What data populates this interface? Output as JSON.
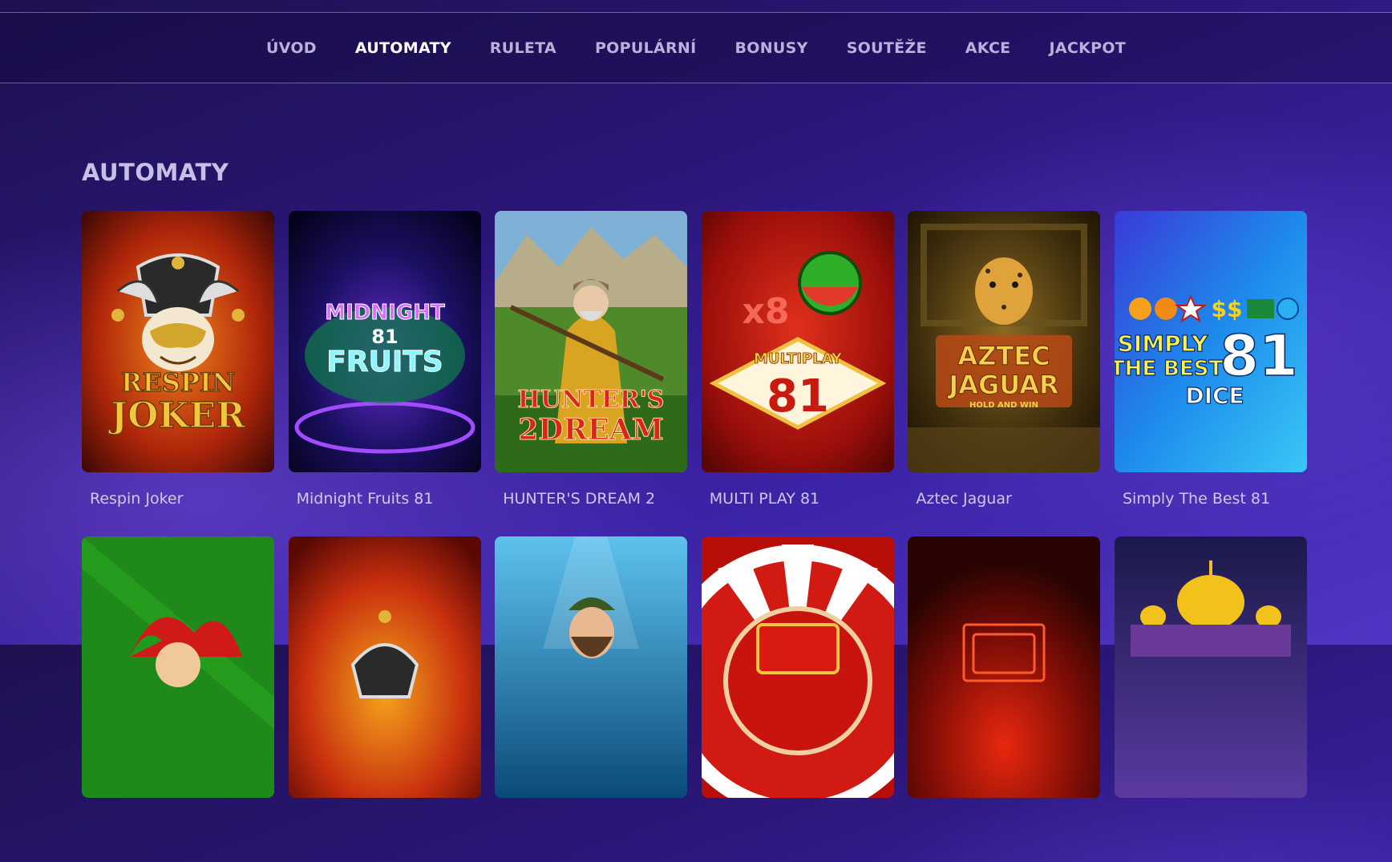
{
  "nav": {
    "items": [
      {
        "label": "ÚVOD",
        "active": false
      },
      {
        "label": "AUTOMATY",
        "active": true
      },
      {
        "label": "RULETA",
        "active": false
      },
      {
        "label": "POPULÁRNÍ",
        "active": false
      },
      {
        "label": "BONUSY",
        "active": false
      },
      {
        "label": "SOUTĚŽE",
        "active": false
      },
      {
        "label": "AKCE",
        "active": false
      },
      {
        "label": "JACKPOT",
        "active": false
      }
    ]
  },
  "section": {
    "title": "AUTOMATY"
  },
  "games_row1": [
    {
      "name": "Respin Joker",
      "art": {
        "line1": "RESPIN",
        "line2": "JOKER"
      }
    },
    {
      "name": "Midnight Fruits 81",
      "art": {
        "line1": "MIDNIGHT",
        "line2": "81",
        "line3": "FRUITS"
      }
    },
    {
      "name": "HUNTER'S DREAM 2",
      "art": {
        "line1": "HUNTER'S",
        "line2": "2DREAM"
      }
    },
    {
      "name": "MULTI PLAY 81",
      "art": {
        "line1": "x8",
        "line2": "MULTIPLAY",
        "line3": "81"
      }
    },
    {
      "name": "Aztec Jaguar",
      "art": {
        "line1": "AZTEC",
        "line2": "JAGUAR",
        "line3": "HOLD AND WIN"
      }
    },
    {
      "name": "Simply The Best 81",
      "art": {
        "line1": "SIMPLY",
        "line2": "THE BEST",
        "line3": "81",
        "line4": "DICE"
      }
    }
  ],
  "games_row2_icons": [
    "jester-green-art",
    "joker-red-art",
    "fisherman-underwater-art",
    "wheel-red-art",
    "neon-red-art",
    "palace-gold-art"
  ],
  "colors": {
    "nav_active": "#ffffff",
    "nav_inactive": "#b9b0dc",
    "title": "#c6bfe6",
    "card_label": "#cfc9ea"
  }
}
